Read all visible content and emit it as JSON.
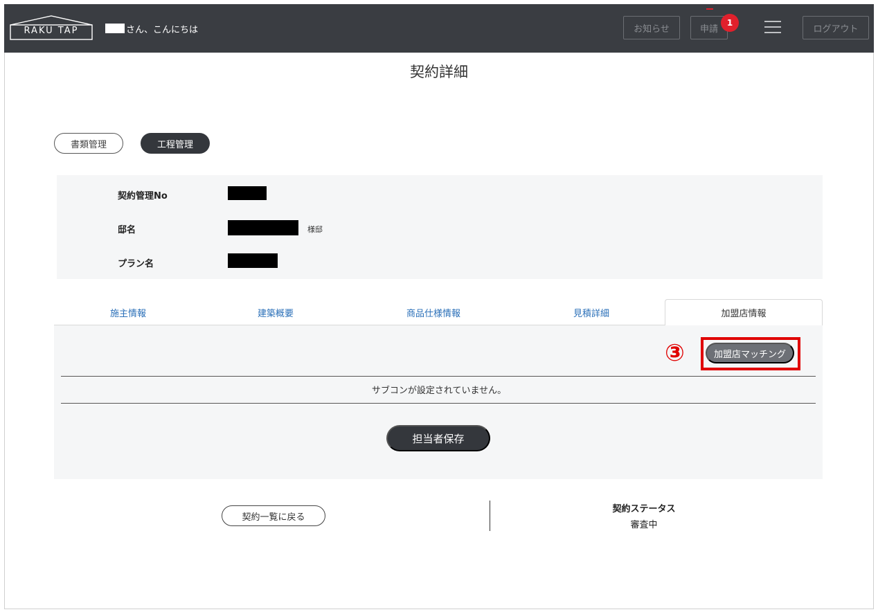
{
  "header": {
    "logo_text": "RAKU TAP",
    "greeting": "さん、こんにちは",
    "notice_label": "お知らせ",
    "apply_label": "申請",
    "apply_badge": "1",
    "logout_label": "ログアウト",
    "menu_icon": "hamburger-icon",
    "bg_color": "#3a3d42"
  },
  "page": {
    "title": "契約詳細"
  },
  "section_tabs": {
    "documents": "書類管理",
    "process": "工程管理",
    "active": "工程管理"
  },
  "info": {
    "contract_no_label": "契約管理No",
    "residence_label": "邸名",
    "residence_suffix": "様邸",
    "plan_label": "プラン名"
  },
  "tabs": {
    "items": [
      "施主情報",
      "建築概要",
      "商品仕様情報",
      "見積詳細",
      "加盟店情報"
    ],
    "active_index": 4
  },
  "content": {
    "match_button": "加盟店マッチング",
    "step_marker": "③",
    "empty_message": "サブコンが設定されていません。",
    "save_button": "担当者保存",
    "highlight_color": "#e00000"
  },
  "footer": {
    "back_button": "契約一覧に戻る",
    "status_label": "契約ステータス",
    "status_value": "審査中"
  }
}
